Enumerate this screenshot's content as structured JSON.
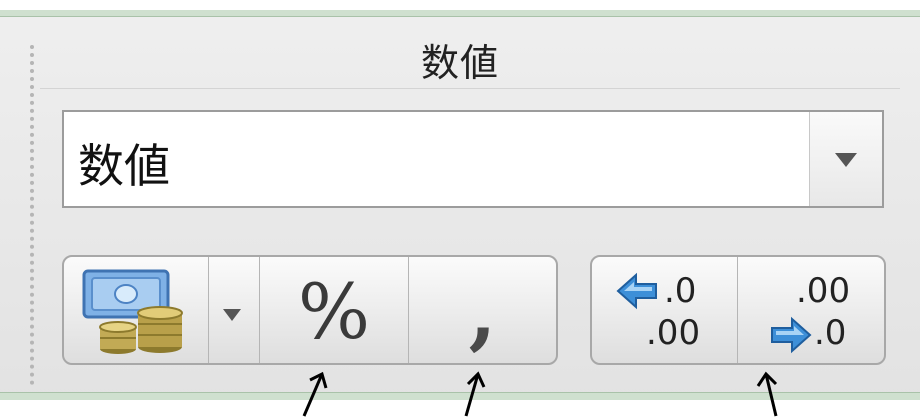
{
  "group": {
    "title": "数値"
  },
  "number_format": {
    "value": "数値"
  },
  "buttons": {
    "percent_label": "%",
    "comma_label": ",",
    "increase_top": ".0",
    "increase_bottom": ".00",
    "decrease_top": ".00",
    "decrease_bottom": ".0"
  },
  "icons": {
    "currency": "currency-icon",
    "dropdown": "chevron-down-icon",
    "increase_arrow": "left-arrow-icon",
    "decrease_arrow": "right-arrow-icon"
  },
  "colors": {
    "panel_border": "#cfe0cf",
    "money": "#7fb1e6",
    "coins": "#b9a04a",
    "decimal_arrow": "#3d8fd8"
  }
}
